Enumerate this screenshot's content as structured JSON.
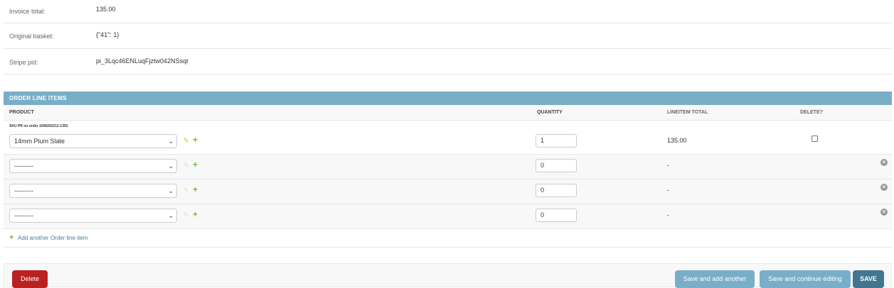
{
  "fields": [
    {
      "label": "Invoice total:",
      "value": "135.00"
    },
    {
      "label": "Original basket:",
      "value": "{\"41\": 1}"
    },
    {
      "label": "Stripe pid:",
      "value": "pi_3Lqc46ENLuqFjztw042NSsqr"
    }
  ],
  "inline": {
    "caption": "ORDER LINE ITEMS",
    "headers": {
      "product": "PRODUCT",
      "quantity": "QUANTITY",
      "total": "LINEITEM TOTAL",
      "delete": "DELETE?"
    },
    "rows": [
      {
        "sku": "SKU PR on order 1008202212-1391",
        "product": "14mm Plum Slate",
        "quantity": "1",
        "total": "135.00",
        "delete_checked": false
      },
      {
        "product": "---------",
        "quantity": "0",
        "total": "-"
      },
      {
        "product": "---------",
        "quantity": "0",
        "total": "-"
      },
      {
        "product": "---------",
        "quantity": "0",
        "total": "-"
      }
    ],
    "add_link": "Add another Order line item"
  },
  "buttons": {
    "delete": "Delete",
    "save_add_another": "Save and add another",
    "save_continue": "Save and continue editing",
    "save": "SAVE"
  },
  "icons": {
    "edit": "pencil-icon",
    "add": "plus-icon",
    "remove": "close-circle-icon",
    "dropdown": "chevron-down-icon"
  },
  "colors": {
    "caption_bg": "#79aec8",
    "save_bg": "#417690",
    "delete_bg": "#ba2121",
    "link": "#447e9b",
    "add_green": "#70bf2b"
  }
}
